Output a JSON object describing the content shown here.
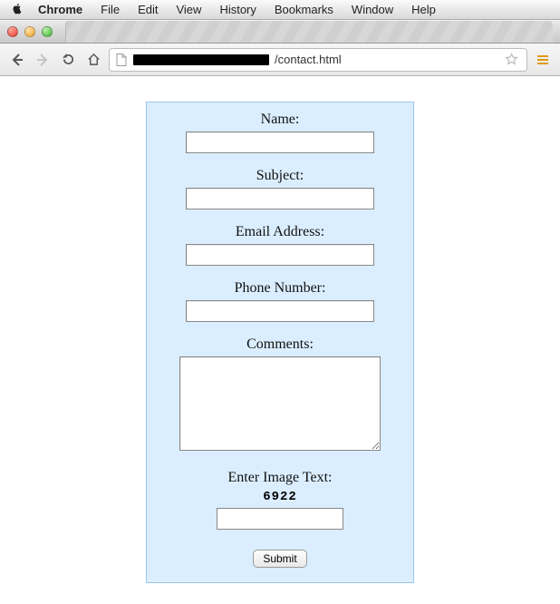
{
  "menubar": {
    "app": "Chrome",
    "items": [
      "File",
      "Edit",
      "View",
      "History",
      "Bookmarks",
      "Window",
      "Help"
    ]
  },
  "toolbar": {
    "url_visible_suffix": "/contact.html"
  },
  "form": {
    "fields": [
      {
        "label": "Name:",
        "value": ""
      },
      {
        "label": "Subject:",
        "value": ""
      },
      {
        "label": "Email Address:",
        "value": ""
      },
      {
        "label": "Phone Number:",
        "value": ""
      }
    ],
    "comments": {
      "label": "Comments:",
      "value": ""
    },
    "captcha": {
      "label": "Enter Image Text:",
      "challenge": "6922",
      "value": ""
    },
    "submit_label": "Submit"
  },
  "colors": {
    "panel_bg": "#dbeeff",
    "panel_border": "#9cc5e9"
  }
}
